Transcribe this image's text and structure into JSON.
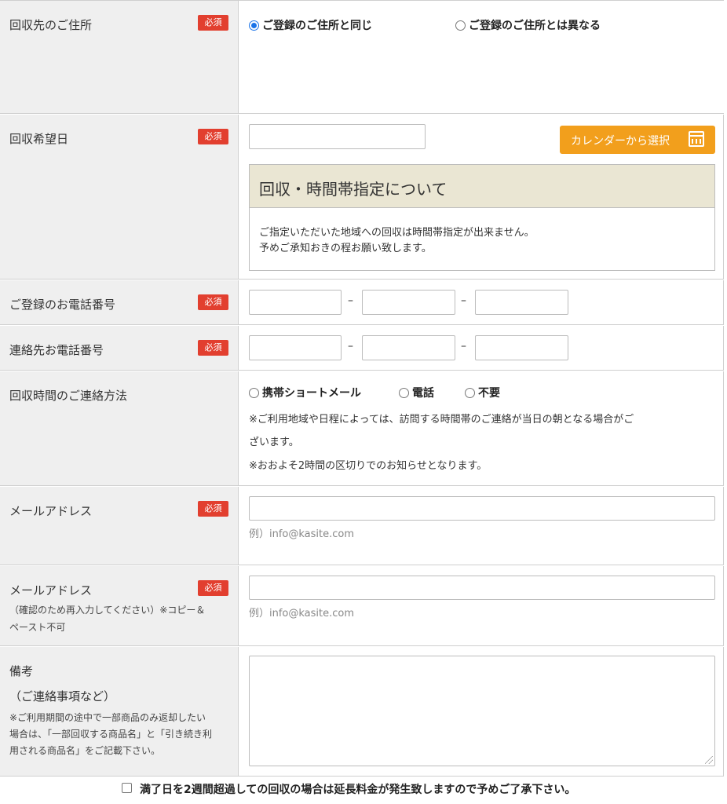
{
  "required_badge": "必須",
  "address": {
    "label": "回収先のご住所",
    "options": [
      "ご登録のご住所と同じ",
      "ご登録のご住所とは異なる"
    ],
    "selected": 0
  },
  "pickup_date": {
    "label": "回収希望日",
    "calendar_button": "カレンダーから選択",
    "notice_title": "回収・時間帯指定について",
    "notice_lines": [
      "ご指定いただいた地域への回収は時間帯指定が出来ません。",
      "予めご承知おきの程お願い致します。"
    ]
  },
  "registered_phone": {
    "label": "ご登録のお電話番号",
    "separator": "–"
  },
  "contact_phone": {
    "label": "連絡先お電話番号",
    "separator": "–"
  },
  "contact_method": {
    "label": "回収時間のご連絡方法",
    "options": [
      "携帯ショートメール",
      "電話",
      "不要"
    ],
    "notes": [
      "※ご利用地域や日程によっては、訪問する時間帯のご連絡が当日の朝となる場合がご",
      "ざいます。",
      "※おおよそ2時間の区切りでのお知らせとなります。"
    ]
  },
  "email": {
    "label": "メールアドレス",
    "hint": "例）info@kasite.com"
  },
  "email_confirm": {
    "label": "メールアドレス",
    "sub_lines": [
      "（確認のため再入力してください）※コピー＆",
      "ペースト不可"
    ],
    "hint": "例）info@kasite.com"
  },
  "remarks": {
    "label": "備考",
    "sub_label": "（ご連絡事項など）",
    "note_lines": [
      "※ご利用期間の途中で一部商品のみ返却したい",
      "場合は、「一部回収する商品名」と「引き続き利",
      "用される商品名」をご記載下さい。"
    ]
  },
  "agreement": "満了日を2週間超過しての回収の場合は延長料金が発生致しますので予めご了承下さい。",
  "colors": {
    "required_badge": "#e23f2f",
    "calendar_button": "#f29f1c",
    "notice_header": "#eae6d3",
    "label_bg": "#efefef",
    "radio_selected": "#1a73e8"
  }
}
